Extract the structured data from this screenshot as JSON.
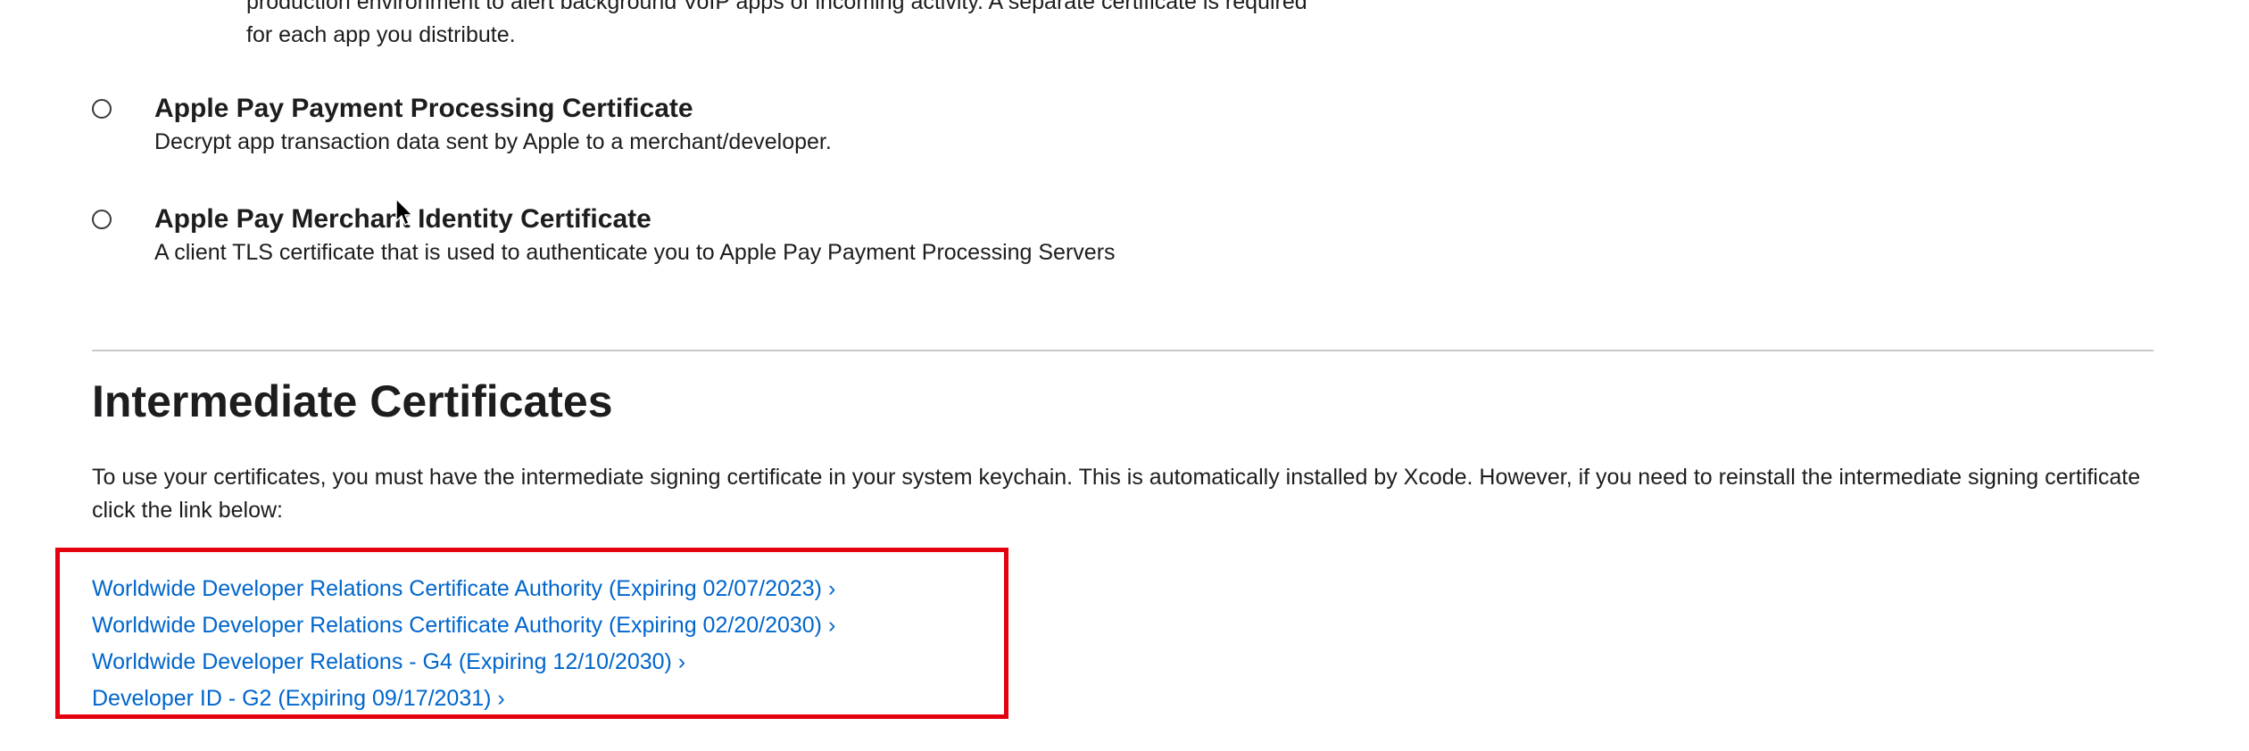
{
  "top_option_partial": {
    "desc_line1": "production environment to alert background VoIP apps of incoming activity. A separate certificate is required",
    "desc_line2": "for each app you distribute."
  },
  "options": [
    {
      "title": "Apple Pay Payment Processing Certificate",
      "description": "Decrypt app transaction data sent by Apple to a merchant/developer."
    },
    {
      "title": "Apple Pay Merchant Identity Certificate",
      "description": "A client TLS certificate that is used to authenticate you to Apple Pay Payment Processing Servers"
    }
  ],
  "intermediate": {
    "title": "Intermediate Certificates",
    "body": "To use your certificates, you must have the intermediate signing certificate in your system keychain. This is automatically installed by Xcode. However, if you need to reinstall the intermediate signing certificate click the link below:",
    "links": [
      "Worldwide Developer Relations Certificate Authority (Expiring 02/07/2023) ›",
      "Worldwide Developer Relations Certificate Authority (Expiring 02/20/2030) ›",
      "Worldwide Developer Relations - G4 (Expiring 12/10/2030) ›",
      "Developer ID - G2 (Expiring 09/17/2031) ›"
    ]
  },
  "colors": {
    "link": "#0066cc",
    "highlight_border": "#e3000f",
    "text": "#1d1d1f"
  }
}
